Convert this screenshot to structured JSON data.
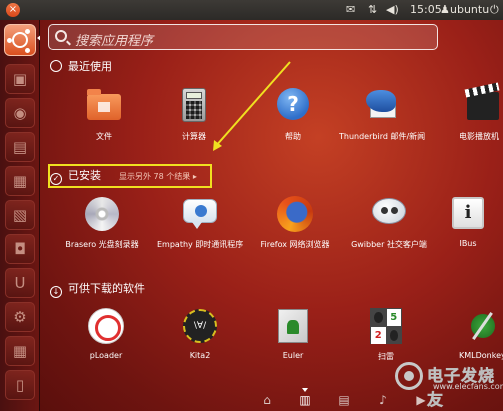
{
  "topbar": {
    "close_glyph": "×",
    "mail_glyph": "✉",
    "network_glyph": "⇅",
    "volume_glyph": "◀)",
    "time": "15:05",
    "user_glyph": "♟",
    "username": "ubuntu",
    "power_glyph": "⏻"
  },
  "search": {
    "placeholder": "搜索应用程序"
  },
  "categories": {
    "recent": {
      "label": "最近使用",
      "icon": "clock-icon"
    },
    "installed": {
      "label": "已安装",
      "more": "显示另外 78 个结果",
      "more_glyph": "▸",
      "icon": "check-icon"
    },
    "available": {
      "label": "可供下载的软件",
      "icon": "down-arrow-icon"
    }
  },
  "recent_apps": [
    {
      "label": "文件",
      "icon": "home-folder-icon"
    },
    {
      "label": "计算器",
      "icon": "calculator-icon"
    },
    {
      "label": "帮助",
      "icon": "help-icon",
      "glyph": "?"
    },
    {
      "label": "Thunderbird 邮件/新闻",
      "icon": "thunderbird-icon"
    },
    {
      "label": "电影播放机",
      "icon": "clapperboard-icon"
    }
  ],
  "installed_apps": [
    {
      "label": "Brasero 光盘刻录器",
      "icon": "disc-icon"
    },
    {
      "label": "Empathy 即时通讯程序",
      "icon": "chat-bubble-icon"
    },
    {
      "label": "Firefox 网络浏览器",
      "icon": "firefox-icon"
    },
    {
      "label": "Gwibber 社交客户端",
      "icon": "gwibber-icon"
    },
    {
      "label": "IBus",
      "icon": "ibus-icon",
      "glyph": "i"
    }
  ],
  "available_apps": [
    {
      "label": "pLoader",
      "icon": "ploader-icon"
    },
    {
      "label": "Kita2",
      "icon": "kita-icon",
      "glyph": "\\∀/"
    },
    {
      "label": "Euler",
      "icon": "euler-icon"
    },
    {
      "label": "扫雷",
      "icon": "minesweeper-icon",
      "cells": [
        "5",
        "2"
      ]
    },
    {
      "label": "KMLDonkey",
      "icon": "kmldonkey-icon"
    }
  ],
  "lenses": [
    {
      "name": "home-lens-icon",
      "glyph": "⌂"
    },
    {
      "name": "applications-lens-icon",
      "glyph": "▥"
    },
    {
      "name": "files-lens-icon",
      "glyph": "▤"
    },
    {
      "name": "music-lens-icon",
      "glyph": "♪"
    },
    {
      "name": "video-lens-icon",
      "glyph": "▶"
    }
  ],
  "watermark": {
    "title": "电子发烧友",
    "url": "www.elecfans.com"
  },
  "colors": {
    "accent": "#dd4814",
    "highlight_box": "#f0e020",
    "dash_bg": "#9a2018"
  }
}
